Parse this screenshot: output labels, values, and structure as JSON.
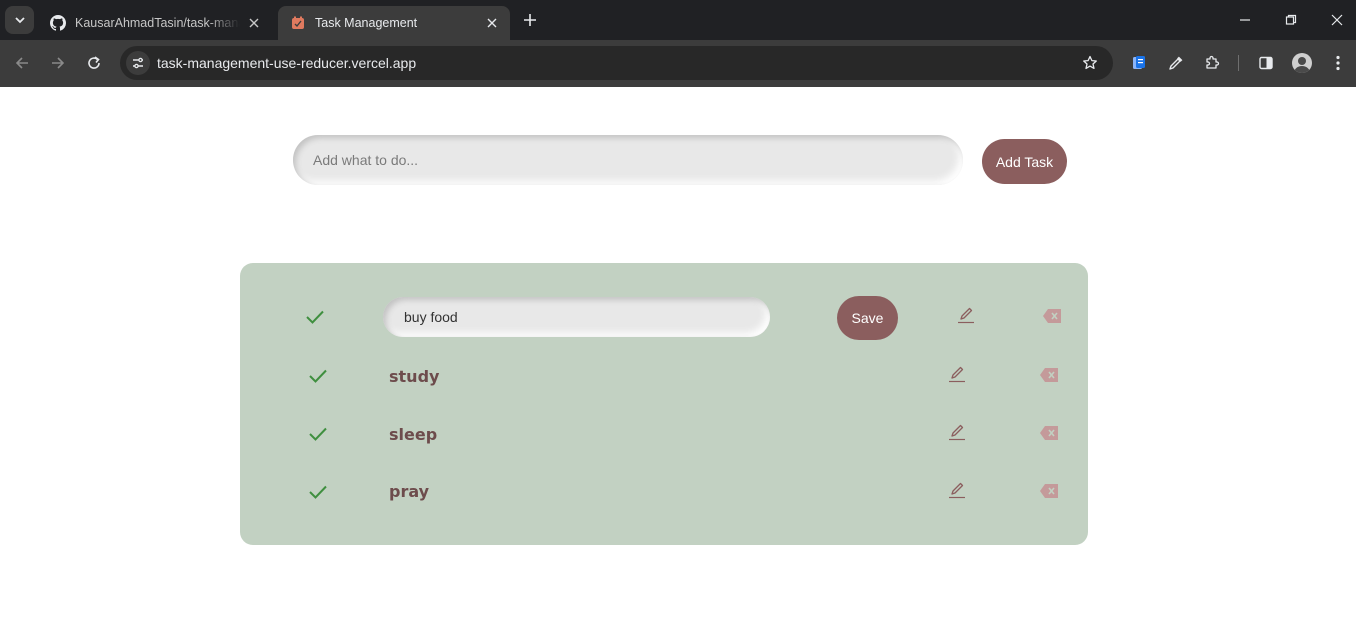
{
  "browser": {
    "tabs": [
      {
        "title": "KausarAhmadTasin/task-management-use-reducer",
        "active": false,
        "icon": "github-icon"
      },
      {
        "title": "Task Management",
        "active": true,
        "icon": "task-favicon"
      }
    ],
    "url": "task-management-use-reducer.vercel.app"
  },
  "form": {
    "placeholder": "Add what to do...",
    "add_button": "Add Task"
  },
  "tasks": [
    {
      "text": "buy food",
      "editing": true,
      "completed_icon": "check-icon"
    },
    {
      "text": "study",
      "editing": false,
      "completed_icon": "check-icon"
    },
    {
      "text": "sleep",
      "editing": false,
      "completed_icon": "check-icon"
    },
    {
      "text": "pray",
      "editing": false,
      "completed_icon": "check-icon"
    }
  ],
  "edit": {
    "save_label": "Save"
  },
  "colors": {
    "accent": "#8b5e5e",
    "panel": "#c2d1c2",
    "check": "#3f8f3f",
    "task_text": "#6d4c4c",
    "delete_icon": "#c49a9a"
  }
}
